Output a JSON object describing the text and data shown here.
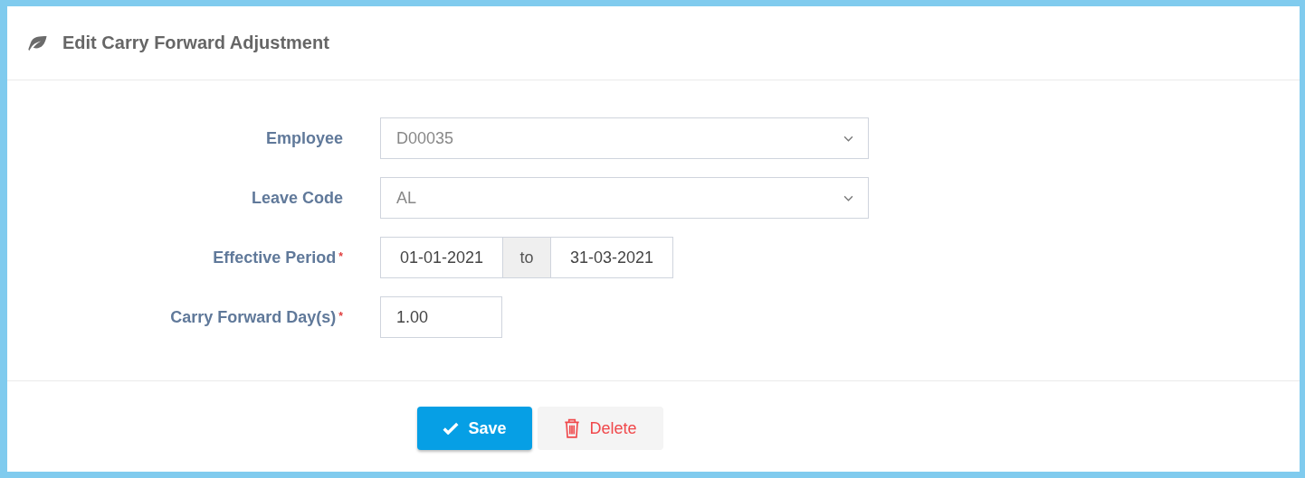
{
  "title": "Edit Carry Forward Adjustment",
  "fields": [
    {
      "kind": "select",
      "label": "Employee",
      "required": false,
      "value": "D00035"
    },
    {
      "kind": "select",
      "label": "Leave Code",
      "required": false,
      "value": "AL"
    },
    {
      "kind": "daterange",
      "label": "Effective Period",
      "required": true,
      "from": "01-01-2021",
      "separator": "to",
      "to": "31-03-2021"
    },
    {
      "kind": "text",
      "label": "Carry Forward Day(s)",
      "required": true,
      "value": "1.00"
    }
  ],
  "required_mark": "*",
  "buttons": [
    {
      "kind": "primary",
      "label": "Save"
    },
    {
      "kind": "danger",
      "label": "Delete"
    }
  ]
}
